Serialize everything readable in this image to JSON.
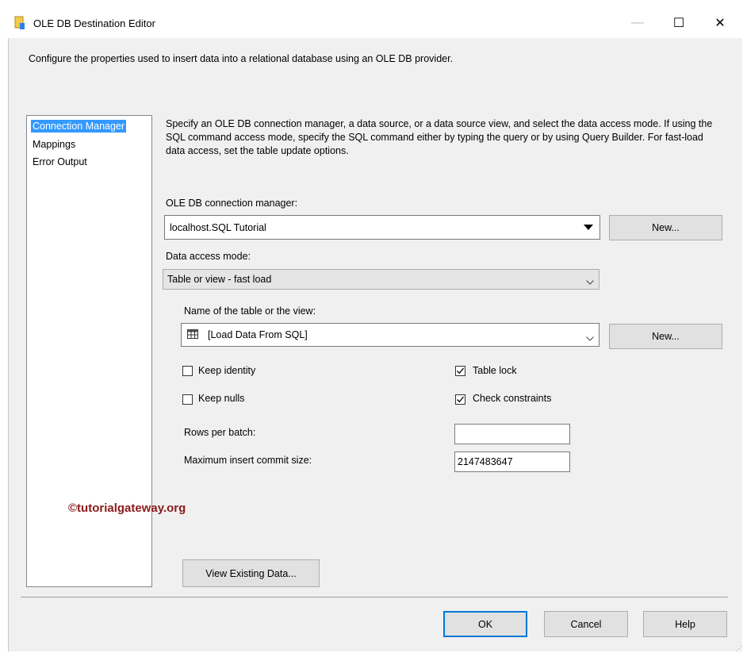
{
  "window": {
    "title": "OLE DB Destination Editor",
    "minimize_glyph": "—",
    "maximize_glyph": "☐",
    "close_glyph": "✕"
  },
  "description": "Configure the properties used to insert data into a relational database using an OLE DB provider.",
  "nav": {
    "items": [
      {
        "label": "Connection Manager",
        "selected": true
      },
      {
        "label": "Mappings",
        "selected": false
      },
      {
        "label": "Error Output",
        "selected": false
      }
    ]
  },
  "intro": "Specify an OLE DB connection manager, a data source, or a data source view, and select the data access mode. If using the SQL command access mode, specify the SQL command either by typing the query or by using Query Builder. For fast-load data access, set the table update options.",
  "connection": {
    "label": "OLE DB connection manager:",
    "value": "localhost.SQL Tutorial",
    "new_label": "New..."
  },
  "access_mode": {
    "label": "Data access mode:",
    "value": "Table or view - fast load"
  },
  "table": {
    "label": "Name of the table or the view:",
    "value": "[Load Data From SQL]",
    "new_label": "New..."
  },
  "options": {
    "keep_identity": {
      "label": "Keep identity",
      "checked": false
    },
    "keep_nulls": {
      "label": "Keep nulls",
      "checked": false
    },
    "table_lock": {
      "label": "Table lock",
      "checked": true
    },
    "check_constraints": {
      "label": "Check constraints",
      "checked": true
    }
  },
  "rows_per_batch": {
    "label": "Rows per batch:",
    "value": ""
  },
  "max_commit": {
    "label": "Maximum insert commit size:",
    "value": "2147483647"
  },
  "watermark": "©tutorialgateway.org",
  "view_data_label": "View Existing Data...",
  "footer": {
    "ok": "OK",
    "cancel": "Cancel",
    "help": "Help"
  },
  "colors": {
    "selection": "#3399ff",
    "default_button_border": "#0078d7",
    "watermark": "#8b1a1a"
  }
}
